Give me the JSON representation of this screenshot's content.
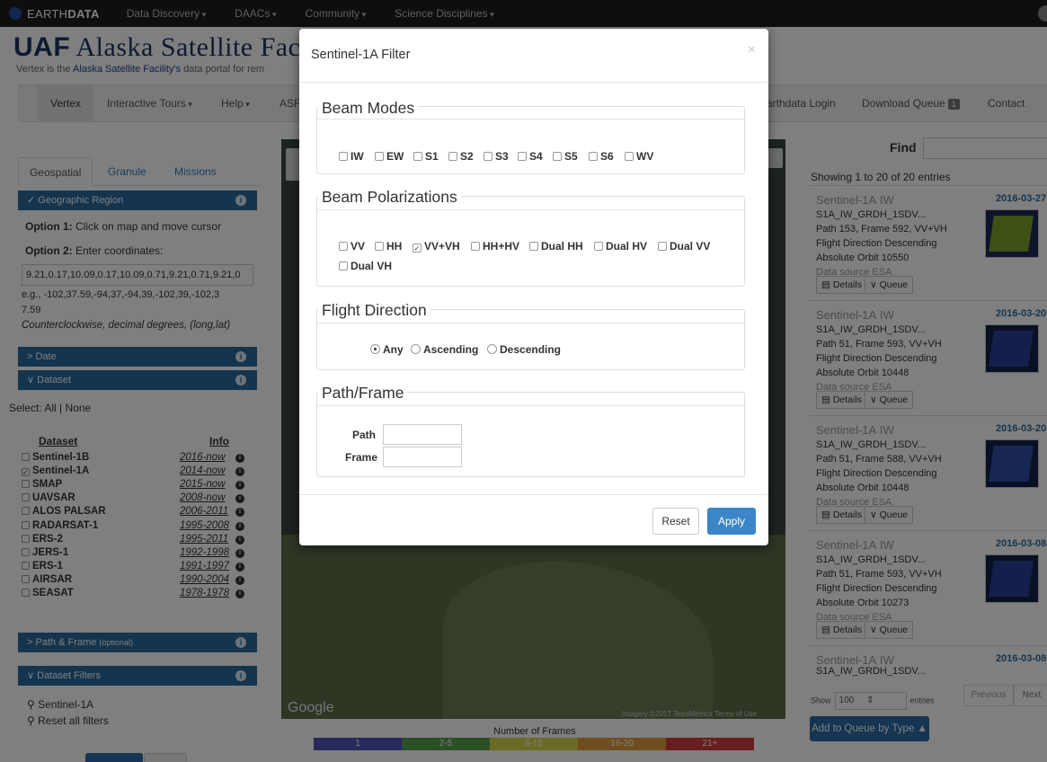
{
  "topbar": {
    "logo_prefix": "EARTH",
    "logo_bold": "DATA",
    "links": [
      "Data Discovery",
      "DAACs",
      "Community",
      "Science Disciplines"
    ]
  },
  "header": {
    "brand_uaf": "UAF",
    "brand_name": "Alaska Satellite Fac",
    "tagline_prefix": "Vertex is the ",
    "tagline_link": "Alaska Satellite Facility's",
    "tagline_suffix": " data portal for rem"
  },
  "nav": {
    "vertex": "Vertex",
    "tours": "Interactive Tours",
    "help": "Help",
    "asf": "ASF",
    "login": "Earthdata Login",
    "queue": "Download Queue",
    "queue_count": "1",
    "contact": "Contact"
  },
  "left": {
    "tabs": [
      "Geospatial",
      "Granule",
      "Missions"
    ],
    "panels": {
      "region": "Geographic Region",
      "date": "Date",
      "dataset": "Dataset",
      "pathframe": "Path & Frame",
      "pathframe_opt": "(optional)",
      "filters": "Dataset Filters"
    },
    "option1_b": "Option 1:",
    "option1": " Click on map and move cursor",
    "option2_b": "Option 2:",
    "option2": " Enter coordinates:",
    "coords_value": "9.21,0.17,10.09,0.17,10.09,0.71,9.21,0.71,9.21,0",
    "example_line1": "e.g., -102,37.59,-94,37,-94,39,-102,39,-102,3",
    "example_line2": "7.59",
    "ccw_note": "Counterclockwise, decimal degrees, (long,lat)",
    "select_label": "Select: All | None",
    "dataset_header": "Dataset",
    "info_header": "Info",
    "datasets": [
      {
        "name": "Sentinel-1B",
        "years": "2016-now",
        "checked": false
      },
      {
        "name": "Sentinel-1A",
        "years": "2014-now",
        "checked": true
      },
      {
        "name": "SMAP",
        "years": "2015-now",
        "checked": false
      },
      {
        "name": "UAVSAR",
        "years": "2008-now",
        "checked": false
      },
      {
        "name": "ALOS PALSAR",
        "years": "2006-2011",
        "checked": false
      },
      {
        "name": "RADARSAT-1",
        "years": "1995-2008",
        "checked": false
      },
      {
        "name": "ERS-2",
        "years": "1995-2011",
        "checked": false
      },
      {
        "name": "JERS-1",
        "years": "1992-1998",
        "checked": false
      },
      {
        "name": "ERS-1",
        "years": "1991-1997",
        "checked": false
      },
      {
        "name": "AIRSAR",
        "years": "1990-2004",
        "checked": false
      },
      {
        "name": "SEASAT",
        "years": "1978-1978",
        "checked": false
      }
    ],
    "filter_item": "Sentinel-1A",
    "reset_filters": "Reset all filters"
  },
  "map": {
    "google": "Google",
    "imagery": "Imagery ©2017 TerraMetrics   Terms of Use",
    "legend_title": "Number of Frames",
    "legend": [
      {
        "label": "1",
        "color": "#5152b8"
      },
      {
        "label": "2-5",
        "color": "#57a04c"
      },
      {
        "label": "6-15",
        "color": "#d8d24a"
      },
      {
        "label": "16-20",
        "color": "#e19a3c"
      },
      {
        "label": "21+",
        "color": "#d03c3c"
      }
    ]
  },
  "right": {
    "find_label": "Find",
    "showing": "Showing 1 to 20 of 20 entries",
    "results": [
      {
        "mission": "Sentinel-1A",
        "mode": "IW",
        "date": "2016-03-27",
        "granule": "S1A_IW_GRDH_1SDV...",
        "pathframe": "Path 153, Frame 592, VV+VH",
        "direction": "Flight Direction Descending",
        "orbit": "Absolute Orbit 10550",
        "source": "Data source ESA"
      },
      {
        "mission": "Sentinel-1A",
        "mode": "IW",
        "date": "2016-03-20",
        "granule": "S1A_IW_GRDH_1SDV...",
        "pathframe": "Path 51, Frame 593, VV+VH",
        "direction": "Flight Direction Descending",
        "orbit": "Absolute Orbit 10448",
        "source": "Data source ESA"
      },
      {
        "mission": "Sentinel-1A",
        "mode": "IW",
        "date": "2016-03-20",
        "granule": "S1A_IW_GRDH_1SDV...",
        "pathframe": "Path 51, Frame 588, VV+VH",
        "direction": "Flight Direction Descending",
        "orbit": "Absolute Orbit 10448",
        "source": "Data source ESA"
      },
      {
        "mission": "Sentinel-1A",
        "mode": "IW",
        "date": "2016-03-08",
        "granule": "S1A_IW_GRDH_1SDV...",
        "pathframe": "Path 51, Frame 593, VV+VH",
        "direction": "Flight Direction Descending",
        "orbit": "Absolute Orbit 10273",
        "source": "Data source ESA"
      },
      {
        "mission": "Sentinel-1A",
        "mode": "IW",
        "date": "2016-03-08",
        "granule": "S1A_IW_GRDH_1SDV...",
        "pathframe": "",
        "direction": "",
        "orbit": "",
        "source": ""
      }
    ],
    "details_label": "Details",
    "queue_label": "Queue",
    "show_label": "Show",
    "show_value": "100",
    "entries_label": "entries",
    "previous": "Previous",
    "next": "Next",
    "add_queue": "Add to Queue by Type"
  },
  "modal": {
    "title": "Sentinel-1A Filter",
    "close": "×",
    "beam_modes_title": "Beam Modes",
    "beam_modes": [
      {
        "label": "IW",
        "checked": false
      },
      {
        "label": "EW",
        "checked": false
      },
      {
        "label": "S1",
        "checked": false
      },
      {
        "label": "S2",
        "checked": false
      },
      {
        "label": "S3",
        "checked": false
      },
      {
        "label": "S4",
        "checked": false
      },
      {
        "label": "S5",
        "checked": false
      },
      {
        "label": "S6",
        "checked": false
      },
      {
        "label": "WV",
        "checked": false
      }
    ],
    "polarizations_title": "Beam Polarizations",
    "polarizations": [
      {
        "label": "VV",
        "checked": false
      },
      {
        "label": "HH",
        "checked": false
      },
      {
        "label": "VV+VH",
        "checked": true
      },
      {
        "label": "HH+HV",
        "checked": false
      },
      {
        "label": "Dual HH",
        "checked": false
      },
      {
        "label": "Dual HV",
        "checked": false
      },
      {
        "label": "Dual VV",
        "checked": false
      },
      {
        "label": "Dual VH",
        "checked": false
      }
    ],
    "direction_title": "Flight Direction",
    "directions": [
      {
        "label": "Any",
        "selected": true
      },
      {
        "label": "Ascending",
        "selected": false
      },
      {
        "label": "Descending",
        "selected": false
      }
    ],
    "pathframe_title": "Path/Frame",
    "path_label": "Path",
    "frame_label": "Frame",
    "path_value": "",
    "frame_value": "",
    "reset": "Reset",
    "apply": "Apply"
  }
}
